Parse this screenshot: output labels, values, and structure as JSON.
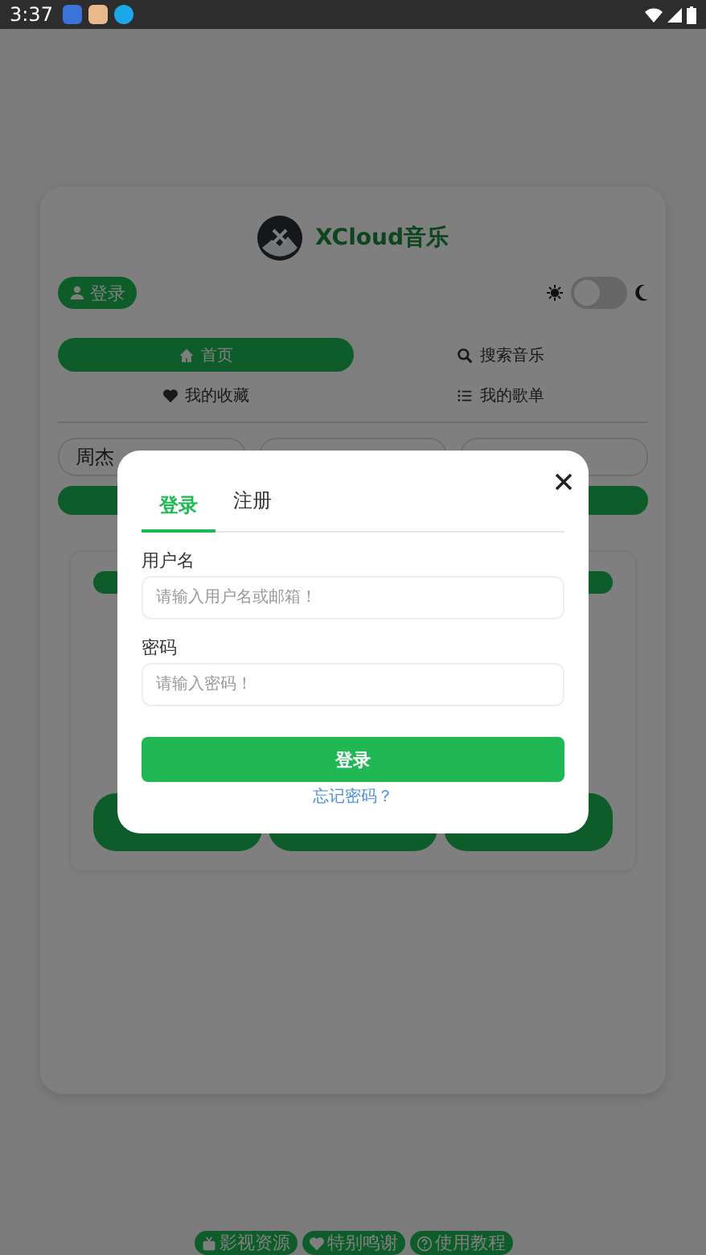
{
  "status_bar": {
    "time": "3:37"
  },
  "app": {
    "title": "XCloud音乐",
    "login_button": "登录",
    "theme_toggle": {
      "on": false
    },
    "nav": [
      {
        "label": "首页",
        "selected": true
      },
      {
        "label": "搜索音乐",
        "selected": false
      },
      {
        "label": "我的收藏",
        "selected": false
      },
      {
        "label": "我的歌单",
        "selected": false
      }
    ],
    "artist_select": {
      "value": "周杰"
    }
  },
  "footer_links": [
    {
      "label": "影视资源"
    },
    {
      "label": "特别鸣谢"
    },
    {
      "label": "使用教程"
    }
  ],
  "dialog": {
    "tabs": [
      {
        "label": "登录",
        "selected": true
      },
      {
        "label": "注册",
        "selected": false
      }
    ],
    "fields": [
      {
        "label": "用户名",
        "placeholder": "请输入用户名或邮箱！"
      },
      {
        "label": "密码",
        "placeholder": "请输入密码！"
      }
    ],
    "submit": "登录",
    "forgot_link": "忘记密码？"
  }
}
